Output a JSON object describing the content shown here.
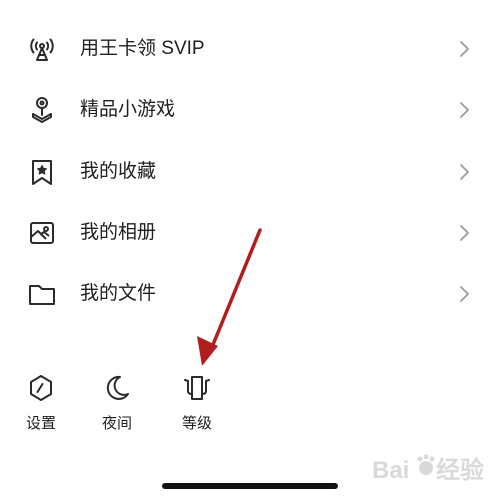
{
  "menu": {
    "items": [
      {
        "label": "用王卡领 SVIP",
        "icon": "antenna-signal-icon"
      },
      {
        "label": "精品小游戏",
        "icon": "joystick-icon"
      },
      {
        "label": "我的收藏",
        "icon": "bookmark-star-icon"
      },
      {
        "label": "我的相册",
        "icon": "photo-album-icon"
      },
      {
        "label": "我的文件",
        "icon": "folder-icon"
      }
    ],
    "chevron_icon": "chevron-right-icon"
  },
  "bottom_bar": {
    "items": [
      {
        "label": "设置",
        "icon": "hexagon-settings-icon"
      },
      {
        "label": "夜间",
        "icon": "moon-icon"
      },
      {
        "label": "等级",
        "icon": "level-badge-icon"
      }
    ]
  },
  "annotation": {
    "color": "#b01e1e"
  },
  "colors": {
    "icon": "#2b2b2b",
    "chevron": "#9a9a9a",
    "text": "#1f1f1f"
  }
}
